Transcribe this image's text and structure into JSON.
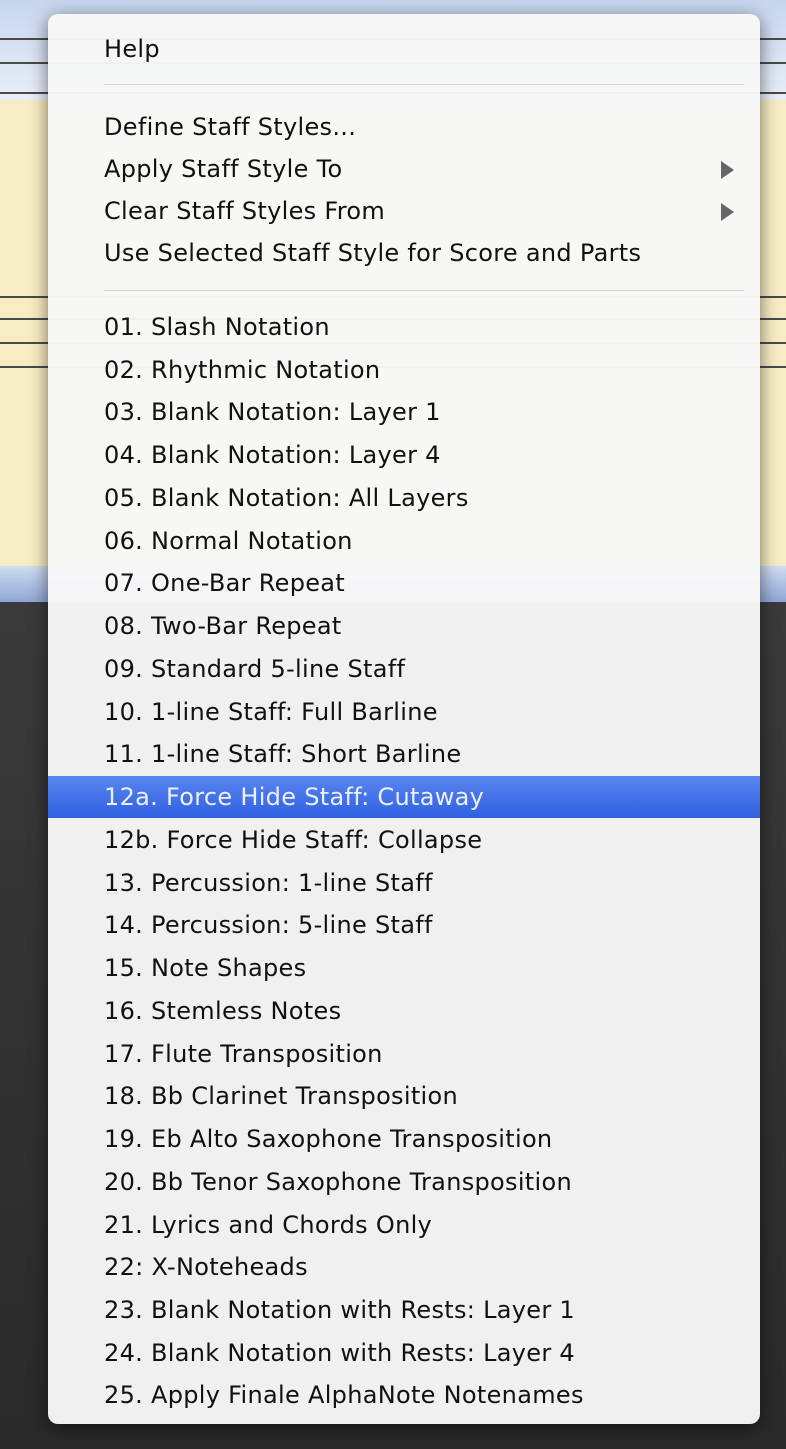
{
  "menu": {
    "help": "Help",
    "top_items": [
      {
        "label": "Define Staff Styles..."
      },
      {
        "label": "Apply Staff Style To",
        "submenu": true
      },
      {
        "label": "Clear Staff Styles From",
        "submenu": true
      },
      {
        "label": "Use Selected Staff Style for Score and Parts"
      }
    ],
    "styles": [
      "01.  Slash Notation",
      "02.  Rhythmic Notation",
      "03.  Blank Notation:  Layer 1",
      "04.  Blank Notation:  Layer 4",
      "05.  Blank Notation:  All Layers",
      "06.  Normal Notation",
      "07.  One-Bar Repeat",
      "08.  Two-Bar Repeat",
      "09.  Standard 5-line Staff",
      "10.  1-line Staff:  Full Barline",
      "11.  1-line Staff:  Short Barline",
      "12a. Force Hide Staff: Cutaway",
      "12b. Force Hide Staff: Collapse",
      "13.  Percussion:  1-line Staff",
      "14.  Percussion:  5-line Staff",
      "15.  Note Shapes",
      "16.  Stemless Notes",
      "17.  Flute Transposition",
      "18.  Bb Clarinet Transposition",
      "19.  Eb Alto Saxophone Transposition",
      "20.  Bb Tenor Saxophone Transposition",
      "21.  Lyrics and Chords Only",
      "22:  X-Noteheads",
      "23.  Blank Notation with Rests: Layer 1",
      "24.  Blank Notation with Rests: Layer 4",
      "25. Apply Finale AlphaNote Notenames"
    ],
    "highlighted_label": "12a. Force Hide Staff: Cutaway"
  },
  "colors": {
    "highlight": "#2f60e0",
    "menu_bg": "#f7f7f7",
    "window_bg": "#f7edc4"
  }
}
